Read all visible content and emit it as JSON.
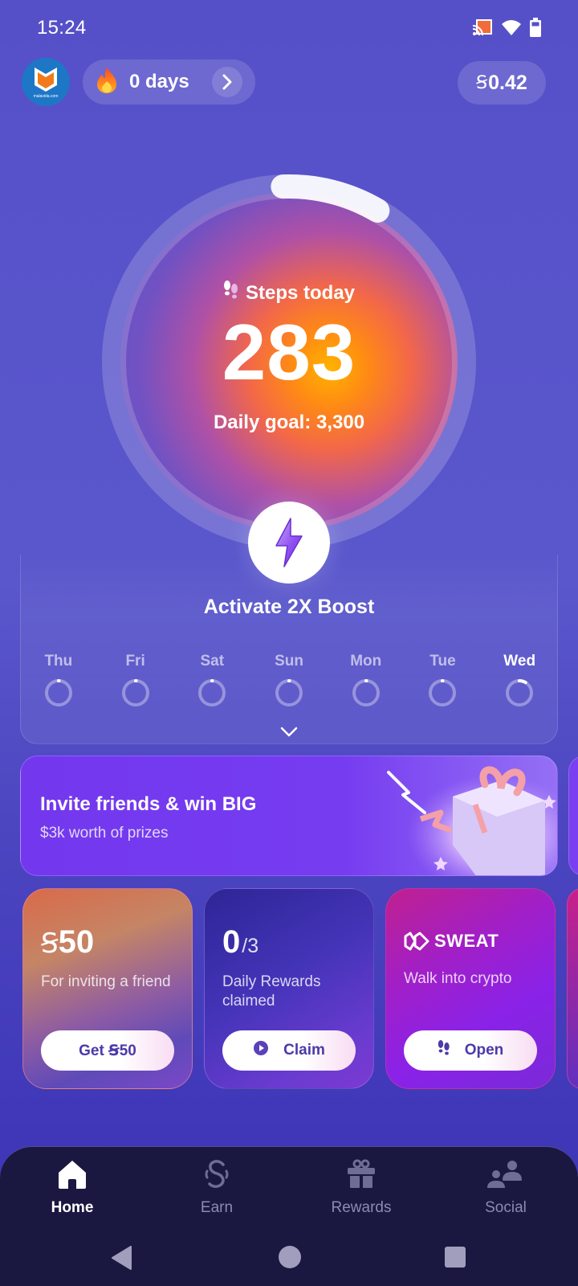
{
  "status_bar": {
    "time": "15:24",
    "icons": [
      "cast-icon",
      "wifi-icon",
      "battery-icon"
    ]
  },
  "header": {
    "avatar_label": "malavida.com",
    "streak": {
      "icon": "fire-icon",
      "label": "0 days"
    },
    "balance": {
      "currency_symbol": "Ꞩ",
      "value": "0.42"
    }
  },
  "steps_ring": {
    "label": "Steps today",
    "steps": "283",
    "goal_text": "Daily goal: 3,300",
    "progress_fraction": 0.086
  },
  "boost": {
    "label": "Activate 2X Boost"
  },
  "week": {
    "days": [
      {
        "label": "Thu",
        "progress": 0.0,
        "current": false
      },
      {
        "label": "Fri",
        "progress": 0.0,
        "current": false
      },
      {
        "label": "Sat",
        "progress": 0.0,
        "current": false
      },
      {
        "label": "Sun",
        "progress": 0.0,
        "current": false
      },
      {
        "label": "Mon",
        "progress": 0.0,
        "current": false
      },
      {
        "label": "Tue",
        "progress": 0.0,
        "current": false
      },
      {
        "label": "Wed",
        "progress": 0.086,
        "current": true
      }
    ]
  },
  "invite_banner": {
    "title": "Invite friends & win BIG",
    "subtitle": "$3k worth of prizes"
  },
  "cards": [
    {
      "head_symbol": "Ꞩ",
      "head": "50",
      "head_sub": "",
      "description": "For inviting a friend",
      "button": "Get Ꞩ50",
      "button_icon": ""
    },
    {
      "head_symbol": "",
      "head": "0",
      "head_sub": "/3",
      "description": "Daily Rewards claimed",
      "button": "Claim",
      "button_icon": "play-icon"
    },
    {
      "brand": "SWEAT",
      "description": "Walk into crypto",
      "button": "Open",
      "button_icon": "footsteps-icon"
    }
  ],
  "bottom_nav": {
    "items": [
      {
        "label": "Home",
        "icon": "home-icon",
        "active": true
      },
      {
        "label": "Earn",
        "icon": "sweatcoin-icon",
        "active": false
      },
      {
        "label": "Rewards",
        "icon": "gift-icon",
        "active": false
      },
      {
        "label": "Social",
        "icon": "people-icon",
        "active": false
      }
    ]
  },
  "colors": {
    "background": "#5650c8",
    "nav_bg": "#1a1840",
    "button_text": "#4b3aa8",
    "invite_bg": "#7338ee"
  }
}
